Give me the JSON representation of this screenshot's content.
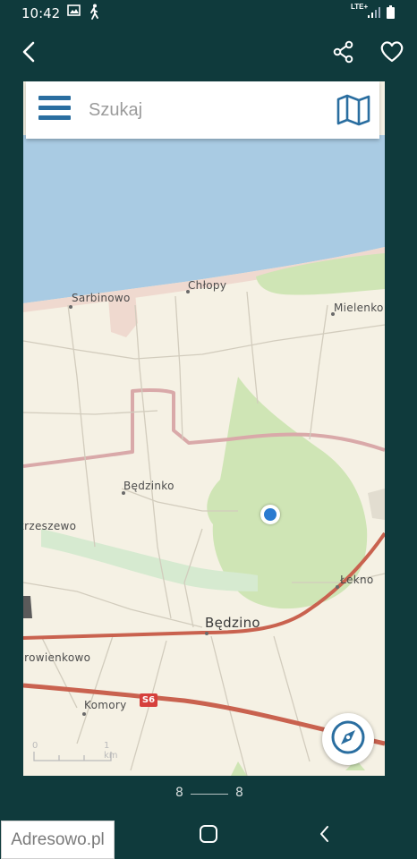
{
  "status_bar": {
    "time": "10:42",
    "network": "LTE+"
  },
  "toolbar": {
    "back_icon": "back-arrow-icon",
    "share_icon": "share-icon",
    "favorite_icon": "heart-outline-icon"
  },
  "map": {
    "search": {
      "menu_icon": "hamburger-menu-icon",
      "placeholder": "Szukaj",
      "map_icon": "folded-map-icon"
    },
    "places": {
      "sarbinowo": "Sarbinowo",
      "chlopy": "Chłopy",
      "mielenko": "Mielenko",
      "bedzinko": "Będzinko",
      "skrzeszewo": "Skrzeszewo",
      "lekno": "Łekno",
      "bedzino": "Będzino",
      "dobrowienkowo": "Dobrowienkowo",
      "komory": "Komory"
    },
    "road_shield": "S6",
    "scale": {
      "zero": "0",
      "distance": "1 km"
    },
    "colors": {
      "sea": "#a9cbe3",
      "land": "#f5f1e4",
      "forest": "#cfe5b5",
      "road": "#c9624f",
      "border": "#d9a9a9",
      "pin": "#2a7bd0"
    }
  },
  "pager": {
    "current": "8",
    "total": "8"
  },
  "watermark": "Adresowo.pl"
}
